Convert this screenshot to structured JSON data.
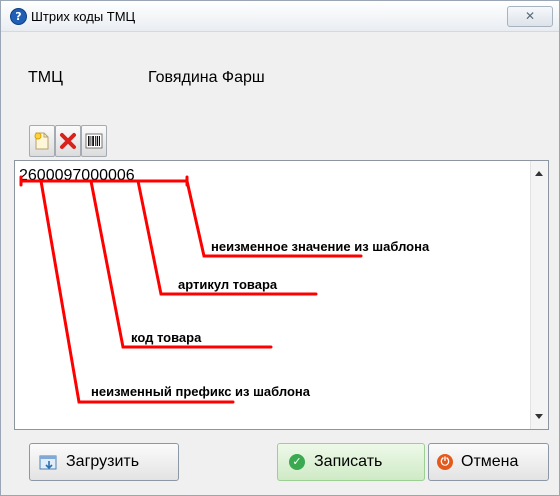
{
  "window": {
    "title": "Штрих коды ТМЦ",
    "close_glyph": "✕"
  },
  "field": {
    "label": "ТМЦ",
    "value": "Говядина Фарш"
  },
  "toolbar": {
    "icons": [
      "new-document-icon",
      "delete-icon",
      "barcode-icon"
    ]
  },
  "editor": {
    "text": "2600097000006"
  },
  "annotations": {
    "constant": "неизменное значение из шаблона",
    "article": "артикул товара",
    "code": "код товара",
    "prefix": "неизменный префикс из шаблона"
  },
  "buttons": {
    "load": "Загрузить",
    "save": "Записать",
    "cancel": "Отмена"
  },
  "colors": {
    "annotation_line": "#ff0000",
    "save_icon": "#3aa94f",
    "cancel_icon": "#e45a1c"
  }
}
